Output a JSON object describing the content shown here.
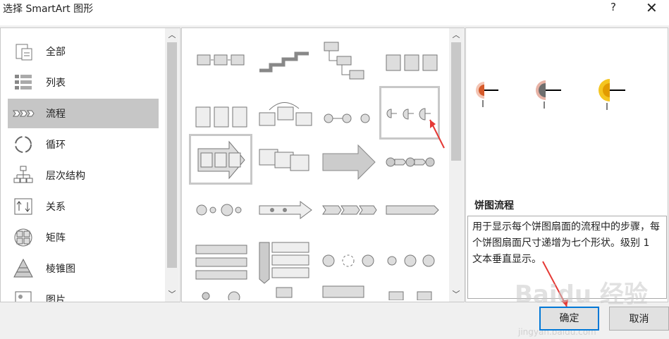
{
  "dialog": {
    "title": "选择 SmartArt 图形",
    "help_label": "?",
    "close_label": "✕"
  },
  "categories": [
    {
      "label": "全部",
      "icon": "all-icon"
    },
    {
      "label": "列表",
      "icon": "list-icon"
    },
    {
      "label": "流程",
      "icon": "process-icon",
      "selected": true
    },
    {
      "label": "循环",
      "icon": "cycle-icon"
    },
    {
      "label": "层次结构",
      "icon": "hierarchy-icon"
    },
    {
      "label": "关系",
      "icon": "relationship-icon"
    },
    {
      "label": "矩阵",
      "icon": "matrix-icon"
    },
    {
      "label": "棱锥图",
      "icon": "pyramid-icon"
    },
    {
      "label": "图片",
      "icon": "picture-icon"
    }
  ],
  "detail": {
    "name": "饼图流程",
    "description": "用于显示每个饼图扇面的流程中的步骤，每个饼图扇面尺寸递增为七个形状。级别 1 文本垂直显示。"
  },
  "buttons": {
    "ok_label": "确定",
    "cancel_label": "取消"
  },
  "scroll": {
    "up": "︿",
    "down": "﹀"
  },
  "watermark": {
    "text": "Baidu 经验",
    "sub": "jingyan.baidu.com"
  },
  "colors": {
    "accent": "#0078d7",
    "selected_bg": "#c6c6c6",
    "arrow": "#e53935"
  }
}
